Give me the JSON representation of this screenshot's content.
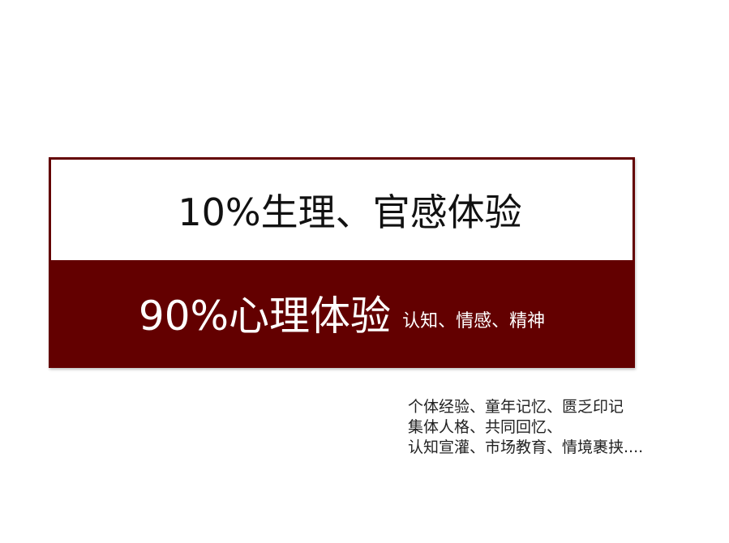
{
  "card": {
    "top_text": "10%生理、官感体验",
    "bottom_main": "90%心理体验",
    "bottom_sub": "认知、情感、精神"
  },
  "notes": [
    "个体经验、童年记忆、匮乏印记",
    "集体人格、共同回忆、",
    "认知宣灌、市场教育、情境裹挟...."
  ],
  "colors": {
    "accent": "#630000",
    "background": "#ffffff"
  }
}
